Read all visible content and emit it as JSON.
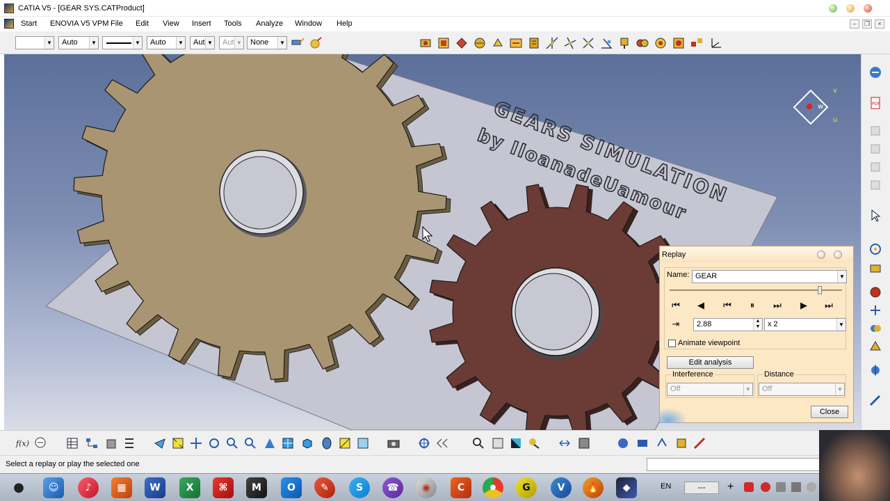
{
  "window": {
    "title": "CATIA V5 - [GEAR SYS.CATProduct]"
  },
  "menu": {
    "items": [
      "Start",
      "ENOVIA V5 VPM",
      "File",
      "Edit",
      "View",
      "Insert",
      "Tools",
      "Analyze",
      "Window",
      "Help"
    ]
  },
  "properties_toolbar": {
    "color_combo": "",
    "transparency_combo": "Auto",
    "linetype_combo": "",
    "thickness_combo": "Auto",
    "point_combo": "Aut",
    "layer_combo_disabled": "Aut",
    "layer_combo": "None"
  },
  "viewport": {
    "model_text_line1": "GEARS SIMULATION",
    "model_text_line2": "by IloanadeUamour",
    "compass": {
      "u_label": "u",
      "v_label": "v",
      "w_label": "w"
    }
  },
  "replay_dialog": {
    "title": "Replay",
    "name_label": "Name:",
    "name_value": "GEAR",
    "slider_position": 0.87,
    "step_value": "2.88",
    "speed_value": "x 2",
    "animate_viewpoint_label": "Animate viewpoint",
    "animate_viewpoint_checked": false,
    "edit_analysis_label": "Edit analysis",
    "interference_label": "Interference",
    "interference_value": "Off",
    "distance_label": "Distance",
    "distance_value": "Off",
    "close_label": "Close"
  },
  "status_bar": {
    "message": "Select a replay or play the selected one"
  },
  "taskbar": {
    "language": "EN",
    "apps": [
      "apple",
      "finder",
      "itunes",
      "office",
      "word",
      "excel",
      "acrobat",
      "maya",
      "outlook",
      "inkscape",
      "skype",
      "viber",
      "camtasia",
      "ccleaner",
      "chrome",
      "garmin",
      "vlc",
      "firefox",
      "catia"
    ],
    "clock_placeholder": "---"
  },
  "colors": {
    "gear_large": "#a99572",
    "gear_small": "#6b3b36",
    "plate": "#c4c4d0",
    "dialog_bg": "#fde8c6"
  }
}
